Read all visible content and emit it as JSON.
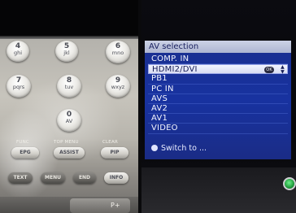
{
  "remote": {
    "keys": [
      {
        "num": "4",
        "letters": "ghi"
      },
      {
        "num": "5",
        "letters": "jkl"
      },
      {
        "num": "6",
        "letters": "mno"
      },
      {
        "num": "7",
        "letters": "pqrs"
      },
      {
        "num": "8",
        "letters": "tuv"
      },
      {
        "num": "9",
        "letters": "wxyz"
      },
      {
        "num": "0",
        "letters": "AV"
      }
    ],
    "captions": {
      "func": "FUNC",
      "top_menu": "TOP MENU",
      "clear": "CLEAR"
    },
    "pills": {
      "epg": "EPG",
      "assist": "ASSIST",
      "pip": "PIP",
      "text": "TEXT",
      "menu": "MENU",
      "end": "END",
      "info": "INFO",
      "p_plus": "P+"
    }
  },
  "tv": {
    "panel_title": "AV selection",
    "items": [
      {
        "label": "COMP. IN",
        "selected": false
      },
      {
        "label": "HDMI2/DVI",
        "selected": true
      },
      {
        "label": "PB1",
        "selected": false
      },
      {
        "label": "PC IN",
        "selected": false
      },
      {
        "label": "AVS",
        "selected": false
      },
      {
        "label": "AV2",
        "selected": false
      },
      {
        "label": "AV1",
        "selected": false
      },
      {
        "label": "VIDEO",
        "selected": false
      }
    ],
    "ok_label": "OK",
    "footer": "Switch to ...",
    "colors": {
      "panel_bg": "#1a2f8f",
      "title_bg": "#c4cbe2",
      "selected_bg": "#e8ebfa",
      "power_led": "#36c85a"
    }
  }
}
